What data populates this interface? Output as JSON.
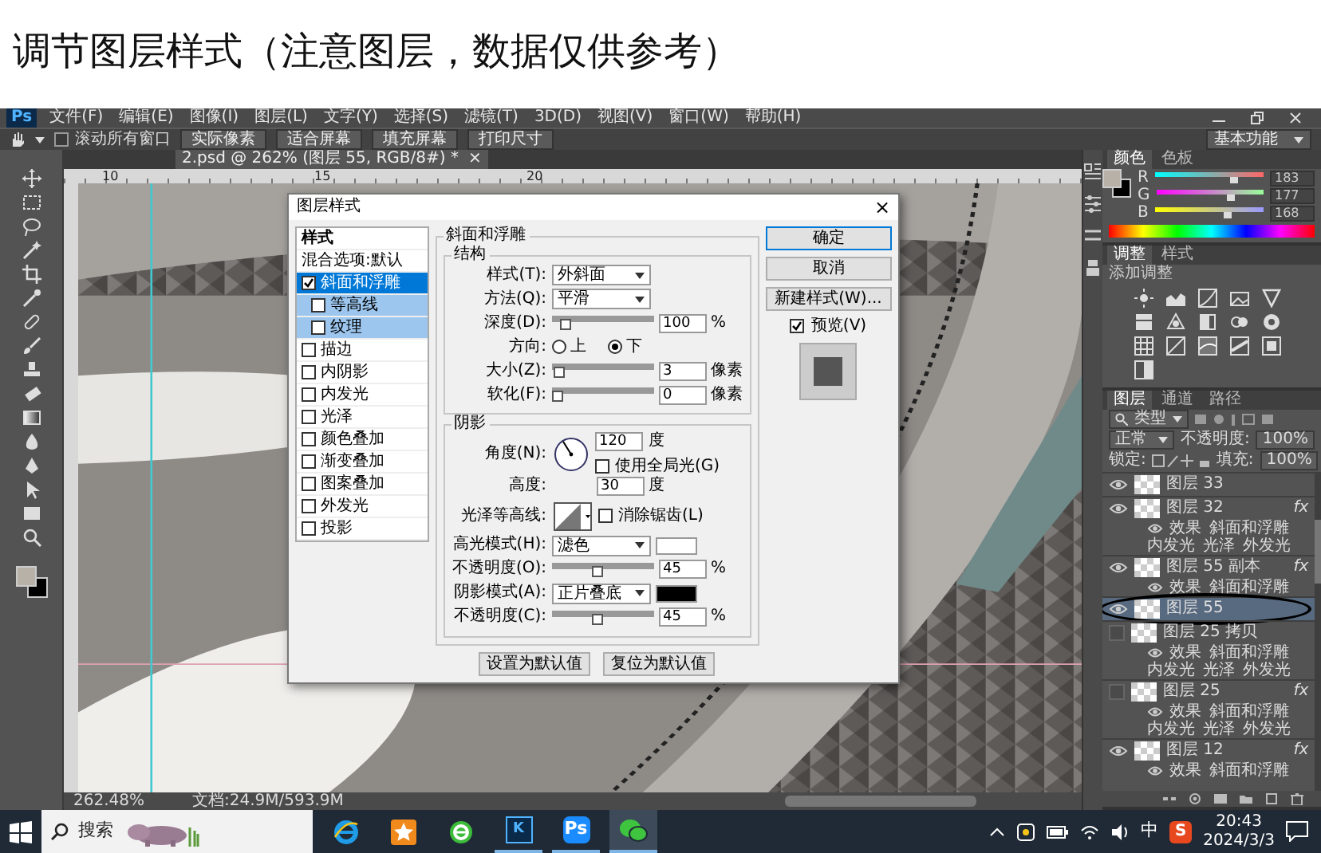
{
  "caption": "调节图层样式（注意图层，数据仅供参考）",
  "app": {
    "logo": "Ps",
    "menu": [
      "文件(F)",
      "编辑(E)",
      "图像(I)",
      "图层(L)",
      "文字(Y)",
      "选择(S)",
      "滤镜(T)",
      "3D(D)",
      "视图(V)",
      "窗口(W)",
      "帮助(H)"
    ],
    "scroll_all": {
      "label": "滚动所有窗口",
      "checked": false
    },
    "option_buttons": [
      "实际像素",
      "适合屏幕",
      "填充屏幕",
      "打印尺寸"
    ],
    "workspace": "基本功能",
    "document_tab": {
      "title": "2.psd @ 262% (图层 55, RGB/8#) *",
      "close": "×"
    },
    "ruler_labels": [
      "10",
      "15",
      "20"
    ],
    "status_bar": {
      "zoom": "262.48%",
      "document": "文档:24.9M/593.9M"
    }
  },
  "dialog": {
    "title": "图层样式",
    "close": "×",
    "style_list": {
      "header": "样式",
      "blend": "混合选项:默认",
      "items": [
        {
          "label": "斜面和浮雕",
          "kind": "main",
          "checked": true,
          "selected": true
        },
        {
          "label": "等高线",
          "kind": "sub",
          "checked": false,
          "selected": false
        },
        {
          "label": "纹理",
          "kind": "sub",
          "checked": false,
          "selected": false
        },
        {
          "label": "描边",
          "kind": "main",
          "checked": false,
          "selected": false
        },
        {
          "label": "内阴影",
          "kind": "main",
          "checked": false,
          "selected": false
        },
        {
          "label": "内发光",
          "kind": "main",
          "checked": false,
          "selected": false
        },
        {
          "label": "光泽",
          "kind": "main",
          "checked": false,
          "selected": false
        },
        {
          "label": "颜色叠加",
          "kind": "main",
          "checked": false,
          "selected": false
        },
        {
          "label": "渐变叠加",
          "kind": "main",
          "checked": false,
          "selected": false
        },
        {
          "label": "图案叠加",
          "kind": "main",
          "checked": false,
          "selected": false
        },
        {
          "label": "外发光",
          "kind": "main",
          "checked": false,
          "selected": false
        },
        {
          "label": "投影",
          "kind": "main",
          "checked": false,
          "selected": false
        }
      ]
    },
    "section_title": "斜面和浮雕",
    "structure": {
      "title": "结构",
      "rows": [
        {
          "kind": "select",
          "label": "样式(T):",
          "value": "外斜面"
        },
        {
          "kind": "select",
          "label": "方法(Q):",
          "value": "平滑"
        },
        {
          "kind": "slider",
          "label": "深度(D):",
          "level": 0.1,
          "value": "100",
          "unit": "%"
        },
        {
          "kind": "radio",
          "label": "方向:",
          "options": [
            {
              "label": "上",
              "selected": false
            },
            {
              "label": "下",
              "selected": true
            }
          ]
        },
        {
          "kind": "slider",
          "label": "大小(Z):",
          "level": 0.02,
          "value": "3",
          "unit": "像素"
        },
        {
          "kind": "slider",
          "label": "软化(F):",
          "level": 0,
          "value": "0",
          "unit": "像素"
        }
      ]
    },
    "shading": {
      "title": "阴影",
      "angle": {
        "label": "角度(N):",
        "value": "120",
        "unit": "度"
      },
      "global_light": {
        "label": "使用全局光(G)",
        "checked": false
      },
      "altitude": {
        "label": "高度:",
        "value": "30",
        "unit": "度"
      },
      "gloss": {
        "label": "光泽等高线:",
        "anti_alias": {
          "label": "消除锯齿(L)",
          "checked": false
        }
      },
      "rows": [
        {
          "kind": "mode",
          "label": "高光模式(H):",
          "value": "滤色",
          "color": "#ffffff"
        },
        {
          "kind": "slider",
          "label": "不透明度(O):",
          "level": 0.45,
          "value": "45",
          "unit": "%"
        },
        {
          "kind": "mode",
          "label": "阴影模式(A):",
          "value": "正片叠底",
          "color": "#000000"
        },
        {
          "kind": "slider",
          "label": "不透明度(C):",
          "level": 0.45,
          "value": "45",
          "unit": "%"
        }
      ]
    },
    "bottom_buttons": [
      "设置为默认值",
      "复位为默认值"
    ],
    "side_buttons": [
      {
        "label": "确定",
        "default": true
      },
      {
        "label": "取消",
        "default": false
      },
      {
        "label": "新建样式(W)...",
        "default": false
      }
    ],
    "preview": {
      "label": "预览(V)",
      "checked": true
    }
  },
  "color_panel": {
    "tabs": [
      {
        "label": "颜色",
        "selected": true
      },
      {
        "label": "色板",
        "selected": false
      }
    ],
    "channels": [
      {
        "name": "R",
        "level": 0.72,
        "value": "183"
      },
      {
        "name": "G",
        "level": 0.69,
        "value": "177"
      },
      {
        "name": "B",
        "level": 0.66,
        "value": "168"
      }
    ]
  },
  "adjust_panel": {
    "tabs": [
      {
        "label": "调整",
        "selected": true
      },
      {
        "label": "样式",
        "selected": false
      }
    ],
    "hint": "添加调整"
  },
  "layers_panel": {
    "tabs": [
      {
        "label": "图层",
        "selected": true
      },
      {
        "label": "通道",
        "selected": false
      },
      {
        "label": "路径",
        "selected": false
      }
    ],
    "filter": "类型",
    "blend_mode": "正常",
    "opacity_label": "不透明度:",
    "opacity": "100%",
    "lock_label": "锁定:",
    "fill_label": "填充:",
    "fill": "100%",
    "layers": [
      {
        "name": "图层 33",
        "visible": true,
        "selected": false
      },
      {
        "name": "图层 32",
        "visible": true,
        "selected": false,
        "fx": "fx",
        "effects": {
          "label": "效果",
          "items": [
            "斜面和浮雕",
            "内发光",
            "光泽",
            "外发光"
          ]
        }
      },
      {
        "name": "图层 55 副本",
        "visible": true,
        "selected": false,
        "fx": "fx",
        "effects": {
          "label": "效果",
          "items": [
            "斜面和浮雕"
          ]
        }
      },
      {
        "name": "图层 55",
        "visible": true,
        "selected": true,
        "annotated": true
      },
      {
        "name": "图层 25 拷贝",
        "visible": false,
        "selected": false,
        "effects": {
          "label": "效果",
          "items": [
            "斜面和浮雕",
            "内发光",
            "光泽",
            "外发光"
          ]
        }
      },
      {
        "name": "图层 25",
        "visible": false,
        "selected": false,
        "fx": "fx",
        "effects": {
          "label": "效果",
          "items": [
            "斜面和浮雕",
            "内发光",
            "光泽",
            "外发光"
          ]
        }
      },
      {
        "name": "图层 12",
        "visible": true,
        "selected": false,
        "fx": "fx",
        "effects": {
          "label": "效果",
          "items": [
            "斜面和浮雕"
          ]
        }
      }
    ]
  },
  "taskbar": {
    "search_placeholder": "搜索",
    "apps": [
      {
        "kind": "blue-browser",
        "running": false,
        "selected": false
      },
      {
        "kind": "star",
        "running": false,
        "selected": false
      },
      {
        "kind": "green-browser",
        "running": false,
        "selected": false
      },
      {
        "kind": "letter",
        "label": "K",
        "running": true,
        "selected": false
      },
      {
        "kind": "letter",
        "label": "Ps",
        "running": true,
        "selected": false
      },
      {
        "kind": "chat",
        "running": true,
        "selected": true
      }
    ],
    "ime": "中",
    "ime_logo": "S",
    "time": "20:43",
    "date": "2024/3/3"
  }
}
